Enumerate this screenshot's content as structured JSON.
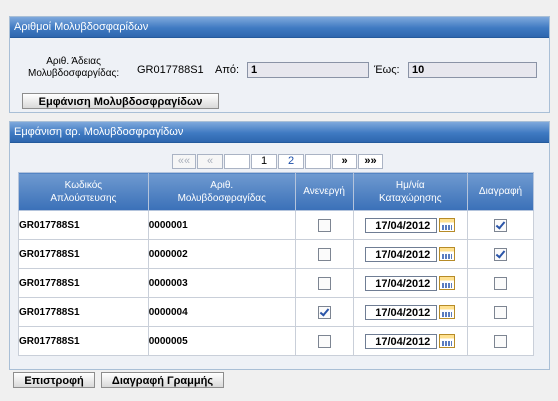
{
  "panel1": {
    "title": "Αριθμοί Μολυβδοσφαρίδων",
    "license_label_line1": "Αριθ. Άδειας",
    "license_label_line2": "Μολυβδοσφαργίδας:",
    "license_value": "GR017788S1",
    "from_label": "Από:",
    "from_value": "1",
    "to_label": "Έως:",
    "to_value": "10",
    "show_button": "Εμφάνιση Μολυβδοσφραγίδων"
  },
  "panel2": {
    "title": "Εμφάνιση αρ. Μολυβδοσφραγίδων",
    "pager": {
      "first": "««",
      "prev": "«",
      "pages": [
        "1",
        "2"
      ],
      "current_page": "1",
      "next": "»",
      "last": "»»"
    },
    "columns": {
      "code_line1": "Κωδικός",
      "code_line2": "Απλούστευσης",
      "seal_line1": "Αριθ.",
      "seal_line2": "Μολυβδοσφραγίδας",
      "inactive": "Ανενεργή",
      "date_line1": "Ημ/νία",
      "date_line2": "Καταχώρησης",
      "delete": "Διαγραφή"
    },
    "rows": [
      {
        "code": "GR017788S1",
        "seal": "0000001",
        "inactive": false,
        "date": "17/04/2012",
        "delete": true
      },
      {
        "code": "GR017788S1",
        "seal": "0000002",
        "inactive": false,
        "date": "17/04/2012",
        "delete": true
      },
      {
        "code": "GR017788S1",
        "seal": "0000003",
        "inactive": false,
        "date": "17/04/2012",
        "delete": false
      },
      {
        "code": "GR017788S1",
        "seal": "0000004",
        "inactive": true,
        "date": "17/04/2012",
        "delete": false
      },
      {
        "code": "GR017788S1",
        "seal": "0000005",
        "inactive": false,
        "date": "17/04/2012",
        "delete": false
      }
    ]
  },
  "footer": {
    "back_button": "Επιστροφή",
    "delete_row_button": "Διαγραφή Γραμμής"
  }
}
